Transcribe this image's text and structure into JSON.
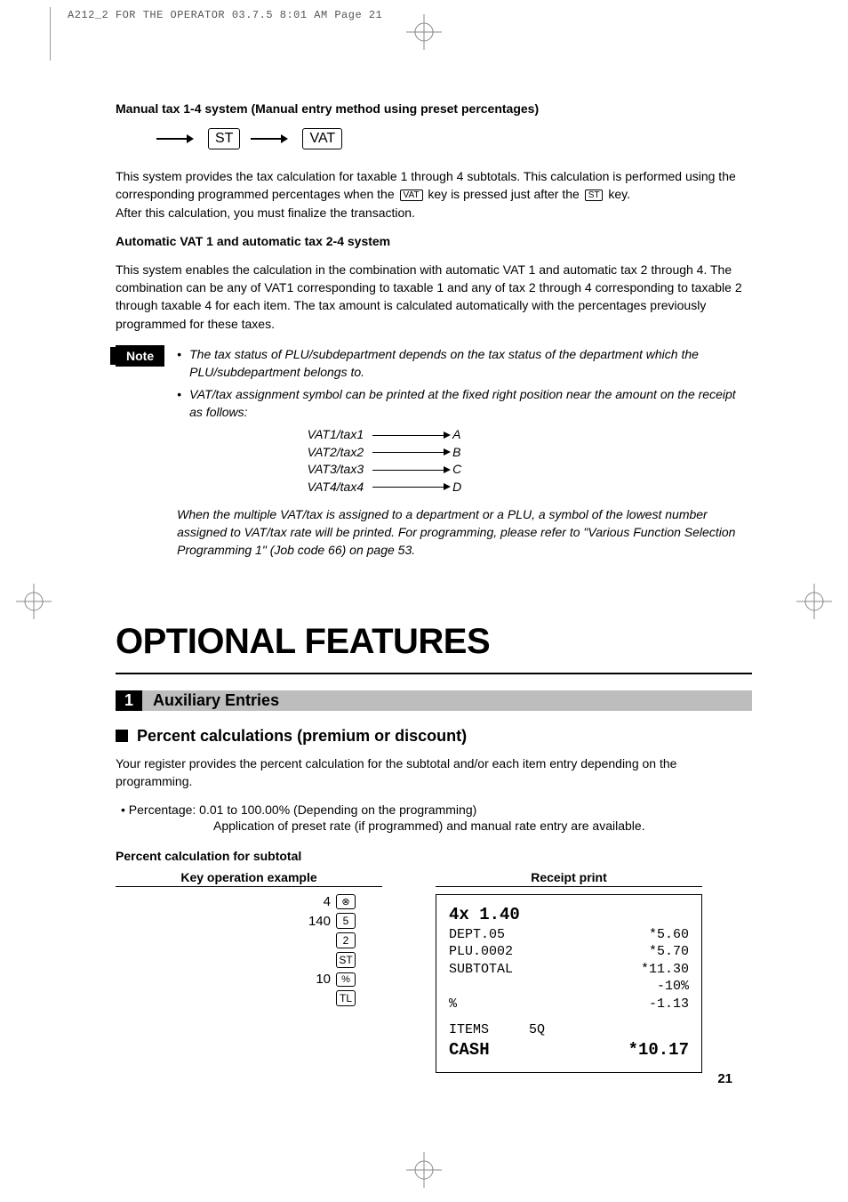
{
  "film_header": "A212_2 FOR THE OPERATOR  03.7.5 8:01 AM  Page 21",
  "manual_tax": {
    "heading": "Manual tax 1-4 system (Manual entry method using preset percentages)",
    "key_st": "ST",
    "key_vat": "VAT",
    "p1a": "This system provides the tax calculation for taxable 1 through 4 subtotals. This calculation is performed using the corresponding programmed percentages when the ",
    "p1_key1": "VAT",
    "p1b": " key is pressed just after the ",
    "p1_key2": "ST",
    "p1c": " key.",
    "p2": "After this calculation, you must finalize the transaction."
  },
  "auto_vat": {
    "heading": "Automatic VAT 1 and automatic tax 2-4 system",
    "body": "This system enables the calculation in the combination with automatic VAT 1 and automatic tax 2 through 4. The combination can be any of VAT1 corresponding to taxable 1 and any of tax 2 through 4 corresponding to taxable 2 through taxable 4 for each item. The tax amount is calculated automatically with the percentages previously programmed for these taxes."
  },
  "note": {
    "label": "Note",
    "li1": "The tax status of PLU/subdepartment depends on the tax status of the department which the PLU/subdepartment belongs to.",
    "li2": "VAT/tax assignment symbol can be printed at the fixed right position near the amount on the receipt as follows:",
    "map": [
      {
        "l": "VAT1/tax1",
        "r": "A"
      },
      {
        "l": "VAT2/tax2",
        "r": "B"
      },
      {
        "l": "VAT3/tax3",
        "r": "C"
      },
      {
        "l": "VAT4/tax4",
        "r": "D"
      }
    ],
    "tail": "When the multiple VAT/tax is assigned to a department or a PLU, a symbol of the lowest number assigned to VAT/tax rate will be printed. For programming, please refer to \"Various Function Selection Programming 1\" (Job code 66) on page 53."
  },
  "optional": {
    "title": "OPTIONAL FEATURES",
    "section_num": "1",
    "section_title": "Auxiliary Entries",
    "subhead": "Percent calculations (premium or discount)",
    "p1": "Your register provides the percent calculation for the subtotal and/or each item entry depending on the programming.",
    "bullet": "• Percentage: 0.01 to 100.00% (Depending on the programming)",
    "indent": "Application of preset rate (if programmed) and manual rate entry are available.",
    "h4": "Percent calculation for subtotal",
    "col1_title": "Key operation example",
    "col2_title": "Receipt print",
    "keyops": [
      {
        "n": "4",
        "k": "⊗"
      },
      {
        "n": "140",
        "k": "5"
      },
      {
        "n": "",
        "k": "2"
      },
      {
        "n": "",
        "k": "ST"
      },
      {
        "n": "10",
        "k": "%"
      },
      {
        "n": "",
        "k": "TL"
      }
    ],
    "receipt": {
      "l1l": "4x 1.40",
      "l1r": "",
      "l2l": "DEPT.05",
      "l2r": "*5.60",
      "l3l": "PLU.0002",
      "l3r": "*5.70",
      "l4l": "SUBTOTAL",
      "l4r": "*11.30",
      "l5l": "",
      "l5r": "-10%",
      "l6l": "%",
      "l6r": "-1.13",
      "l7l": "ITEMS     5Q",
      "l7r": "",
      "l8l": "CASH",
      "l8r": "*10.17"
    }
  },
  "page_number": "21"
}
